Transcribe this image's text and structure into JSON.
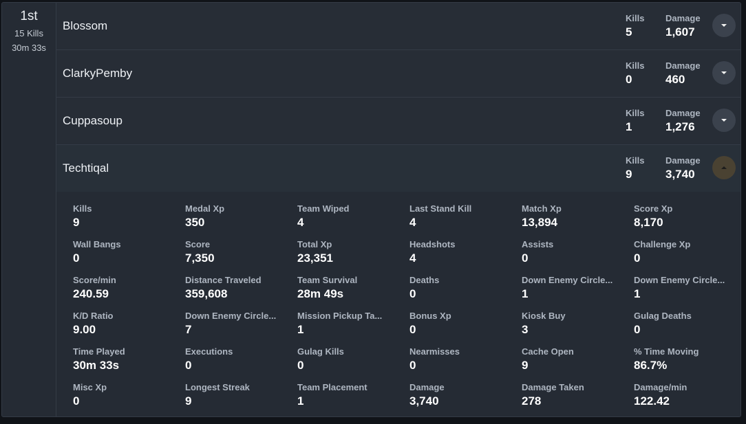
{
  "team": {
    "placement": "1st",
    "kills": "15 Kills",
    "time": "30m 33s"
  },
  "players": [
    {
      "name": "Blossom",
      "kills_label": "Kills",
      "kills": "5",
      "damage_label": "Damage",
      "damage": "1,607",
      "expanded": false
    },
    {
      "name": "ClarkyPemby",
      "kills_label": "Kills",
      "kills": "0",
      "damage_label": "Damage",
      "damage": "460",
      "expanded": false
    },
    {
      "name": "Cuppasoup",
      "kills_label": "Kills",
      "kills": "1",
      "damage_label": "Damage",
      "damage": "1,276",
      "expanded": false
    },
    {
      "name": "Techtiqal",
      "kills_label": "Kills",
      "kills": "9",
      "damage_label": "Damage",
      "damage": "3,740",
      "expanded": true
    }
  ],
  "icons": {
    "collapsed": "chevron-down-icon",
    "expanded": "chevron-up-icon"
  },
  "colors": {
    "toggle_collapsed": "#3b424d",
    "toggle_expanded": "#4a4232"
  },
  "details": [
    {
      "label": "Kills",
      "value": "9"
    },
    {
      "label": "Medal Xp",
      "value": "350"
    },
    {
      "label": "Team Wiped",
      "value": "4"
    },
    {
      "label": "Last Stand Kill",
      "value": "4"
    },
    {
      "label": "Match Xp",
      "value": "13,894"
    },
    {
      "label": "Score Xp",
      "value": "8,170"
    },
    {
      "label": "Wall Bangs",
      "value": "0"
    },
    {
      "label": "Score",
      "value": "7,350"
    },
    {
      "label": "Total Xp",
      "value": "23,351"
    },
    {
      "label": "Headshots",
      "value": "4"
    },
    {
      "label": "Assists",
      "value": "0"
    },
    {
      "label": "Challenge Xp",
      "value": "0"
    },
    {
      "label": "Score/min",
      "value": "240.59"
    },
    {
      "label": "Distance Traveled",
      "value": "359,608"
    },
    {
      "label": "Team Survival",
      "value": "28m 49s"
    },
    {
      "label": "Deaths",
      "value": "0"
    },
    {
      "label": "Down Enemy Circle...",
      "value": "1"
    },
    {
      "label": "Down Enemy Circle...",
      "value": "1"
    },
    {
      "label": "K/D Ratio",
      "value": "9.00"
    },
    {
      "label": "Down Enemy Circle...",
      "value": "7"
    },
    {
      "label": "Mission Pickup Ta...",
      "value": "1"
    },
    {
      "label": "Bonus Xp",
      "value": "0"
    },
    {
      "label": "Kiosk Buy",
      "value": "3"
    },
    {
      "label": "Gulag Deaths",
      "value": "0"
    },
    {
      "label": "Time Played",
      "value": "30m 33s"
    },
    {
      "label": "Executions",
      "value": "0"
    },
    {
      "label": "Gulag Kills",
      "value": "0"
    },
    {
      "label": "Nearmisses",
      "value": "0"
    },
    {
      "label": "Cache Open",
      "value": "9"
    },
    {
      "label": "% Time Moving",
      "value": "86.7%"
    },
    {
      "label": "Misc Xp",
      "value": "0"
    },
    {
      "label": "Longest Streak",
      "value": "9"
    },
    {
      "label": "Team Placement",
      "value": "1"
    },
    {
      "label": "Damage",
      "value": "3,740"
    },
    {
      "label": "Damage Taken",
      "value": "278"
    },
    {
      "label": "Damage/min",
      "value": "122.42"
    }
  ]
}
